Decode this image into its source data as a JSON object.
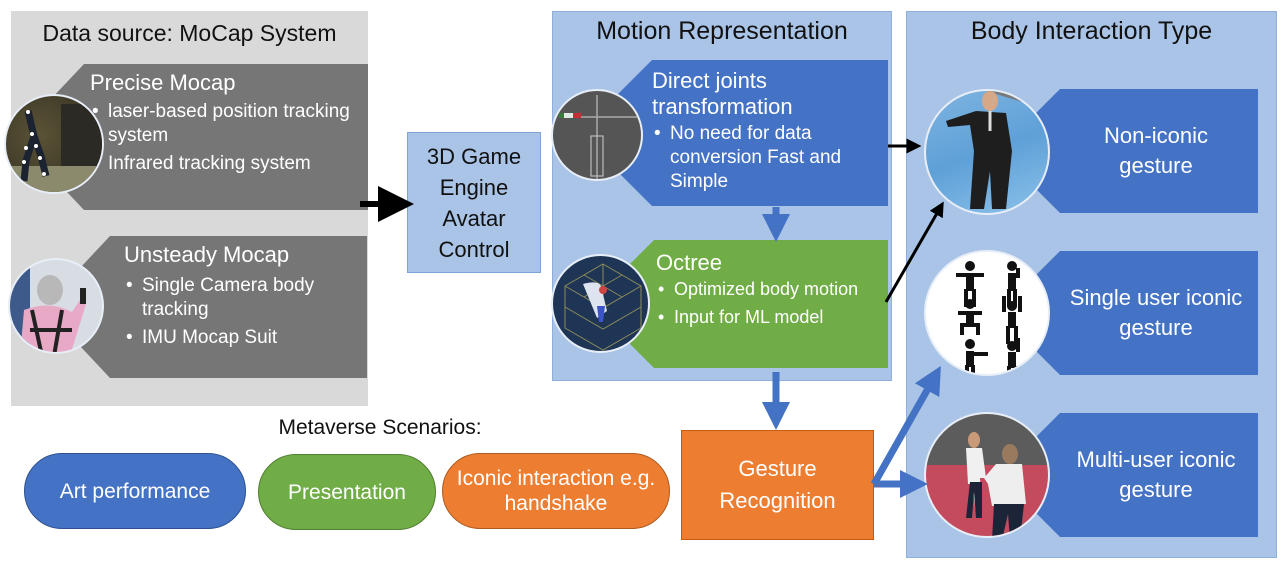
{
  "data_source": {
    "title": "Data source: MoCap System",
    "precise": {
      "heading": "Precise Mocap",
      "bullets": [
        "laser-based position tracking system",
        "Infrared tracking system"
      ],
      "image": "mocap-marker-suit-photo"
    },
    "unsteady": {
      "heading": "Unsteady Mocap",
      "bullets": [
        "Single Camera body tracking",
        "IMU Mocap Suit"
      ],
      "image": "imu-suit-person-photo"
    }
  },
  "engine_box": {
    "label": "3D Game Engine Avatar Control"
  },
  "motion_representation": {
    "title": "Motion Representation",
    "direct": {
      "heading": "Direct joints transformation",
      "bullets": [
        "No need for data conversion Fast and Simple"
      ],
      "image": "skeleton-joints-image"
    },
    "octree": {
      "heading": "Octree",
      "bullets": [
        "Optimized body motion",
        "Input for ML model"
      ],
      "image": "octree-grid-image"
    }
  },
  "gesture_recognition": {
    "label": "Gesture Recognition"
  },
  "body_interaction": {
    "title": "Body Interaction Type",
    "items": [
      {
        "label": "Non-iconic gesture",
        "image": "avatar-suit-image"
      },
      {
        "label": "Single user iconic gesture",
        "image": "pictogram-poses-image"
      },
      {
        "label": "Multi-user iconic gesture",
        "image": "handshake-avatars-image"
      }
    ]
  },
  "scenarios": {
    "title": "Metaverse Scenarios:",
    "items": [
      {
        "label": "Art performance",
        "color": "#4472c4"
      },
      {
        "label": "Presentation",
        "color": "#70ad47"
      },
      {
        "label": "Iconic interaction e.g. handshake",
        "color": "#ed7d31"
      }
    ]
  },
  "colors": {
    "gray_panel": "#d9d9d9",
    "gray_tag": "#767676",
    "blue_panel": "#a9c4e6",
    "blue_tag": "#4472c4",
    "green_tag": "#70ad47",
    "orange": "#ed7d31",
    "arrow_blue": "#4472c4",
    "arrow_black": "#000000"
  }
}
